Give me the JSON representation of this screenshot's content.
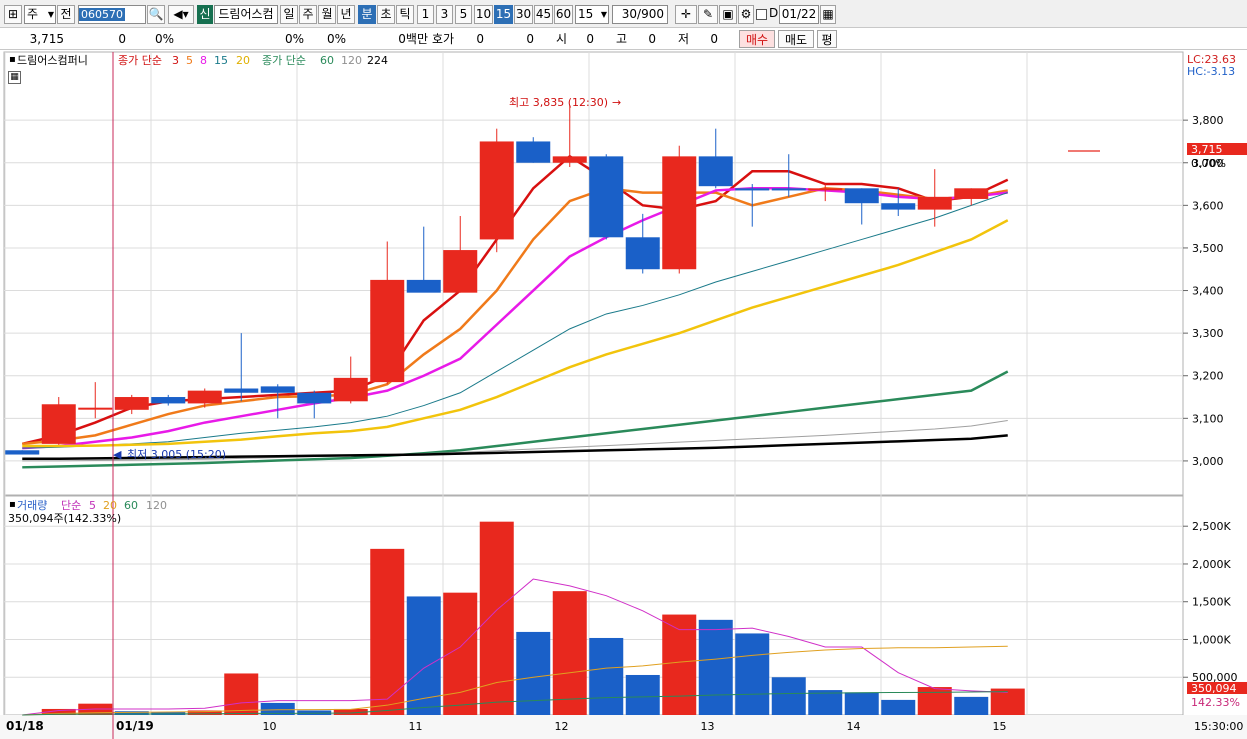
{
  "toolbar": {
    "type_select": "주",
    "prev_label": "전",
    "stock_code": "060570",
    "new_badge": "신",
    "stock_name": "드림어스컴",
    "period_tabs": [
      "일",
      "주",
      "월",
      "년",
      "분",
      "초",
      "틱"
    ],
    "interval_buttons": [
      "1",
      "3",
      "5",
      "10",
      "15",
      "30",
      "45",
      "60"
    ],
    "interval_value": "15",
    "count_value": "30/900",
    "checkbox_label": "D",
    "date_value": "01/22"
  },
  "quote": {
    "price": "3,715",
    "change": "0",
    "change_rate": "0%",
    "v1": "0%",
    "v2": "0%",
    "amount": "0백만",
    "hoga_label": "호가",
    "hoga_v1": "0",
    "hoga_v2": "0",
    "open_label": "시",
    "open": "0",
    "high_label": "고",
    "high": "0",
    "low_label": "저",
    "low": "0",
    "buy_label": "매수",
    "sell_label": "매도",
    "eval_label": "평"
  },
  "price_panel": {
    "stock_tab": "드림어스컴퍼니",
    "ma_title": "종가 단순",
    "ma_periods": [
      "3",
      "5",
      "8",
      "15",
      "20"
    ],
    "ma_title2": "종가 단순",
    "ma_periods2": [
      "60",
      "120",
      "224"
    ],
    "lc_label": "LC:23.63",
    "hc_label": "HC:-3.13",
    "current_price_tag": "3,715",
    "current_pct_tag": "0.00%",
    "high_annotation": "최고 3,835 (12:30)",
    "low_annotation": "최저 3,005 (15:20)"
  },
  "volume_panel": {
    "title": "거래량",
    "ma_title": "단순",
    "ma_periods": [
      "5",
      "20",
      "60",
      "120"
    ],
    "info": "350,094주(142.33%)",
    "current_tag": "350,094",
    "current_pct": "142.33%"
  },
  "axis": {
    "date_left": "01/18",
    "date_first": "01/19",
    "x_labels": [
      "10",
      "11",
      "12",
      "13",
      "14",
      "15"
    ],
    "time_label": "15:30:00"
  },
  "chart_data": {
    "type": "candlestick",
    "price_ylim": [
      2920,
      3960
    ],
    "price_ticks": [
      "3,000",
      "3,100",
      "3,200",
      "3,300",
      "3,400",
      "3,500",
      "3,600",
      "3,700",
      "3,800"
    ],
    "volume_ylim": [
      0,
      2900
    ],
    "volume_ticks": [
      "500,000",
      "1,000K",
      "1,500K",
      "2,000K",
      "2,500K"
    ],
    "candles": [
      {
        "o": 3025,
        "h": 3025,
        "l": 3015,
        "c": 3015
      },
      {
        "o": 3040,
        "h": 3150,
        "l": 3038,
        "c": 3133
      },
      {
        "o": 3125,
        "h": 3185,
        "l": 3100,
        "c": 3125
      },
      {
        "o": 3120,
        "h": 3155,
        "l": 3110,
        "c": 3150
      },
      {
        "o": 3150,
        "h": 3155,
        "l": 3130,
        "c": 3135
      },
      {
        "o": 3135,
        "h": 3170,
        "l": 3125,
        "c": 3165
      },
      {
        "o": 3170,
        "h": 3300,
        "l": 3140,
        "c": 3160
      },
      {
        "o": 3175,
        "h": 3180,
        "l": 3100,
        "c": 3160
      },
      {
        "o": 3160,
        "h": 3165,
        "l": 3100,
        "c": 3135
      },
      {
        "o": 3140,
        "h": 3245,
        "l": 3135,
        "c": 3195
      },
      {
        "o": 3185,
        "h": 3515,
        "l": 3180,
        "c": 3425
      },
      {
        "o": 3425,
        "h": 3550,
        "l": 3400,
        "c": 3395
      },
      {
        "o": 3395,
        "h": 3575,
        "l": 3395,
        "c": 3495
      },
      {
        "o": 3520,
        "h": 3780,
        "l": 3490,
        "c": 3750
      },
      {
        "o": 3750,
        "h": 3760,
        "l": 3700,
        "c": 3700
      },
      {
        "o": 3700,
        "h": 3835,
        "l": 3690,
        "c": 3715
      },
      {
        "o": 3715,
        "h": 3720,
        "l": 3520,
        "c": 3525
      },
      {
        "o": 3525,
        "h": 3580,
        "l": 3440,
        "c": 3450
      },
      {
        "o": 3450,
        "h": 3740,
        "l": 3440,
        "c": 3715
      },
      {
        "o": 3715,
        "h": 3780,
        "l": 3640,
        "c": 3645
      },
      {
        "o": 3640,
        "h": 3650,
        "l": 3550,
        "c": 3635
      },
      {
        "o": 3640,
        "h": 3720,
        "l": 3620,
        "c": 3635
      },
      {
        "o": 3640,
        "h": 3650,
        "l": 3610,
        "c": 3640
      },
      {
        "o": 3640,
        "h": 3640,
        "l": 3555,
        "c": 3605
      },
      {
        "o": 3605,
        "h": 3640,
        "l": 3575,
        "c": 3590
      },
      {
        "o": 3590,
        "h": 3685,
        "l": 3550,
        "c": 3620
      },
      {
        "o": 3615,
        "h": 3640,
        "l": 3600,
        "c": 3640
      },
      {
        "o": 3715,
        "h": 3715,
        "l": 3715,
        "c": 3715
      }
    ],
    "ma_series": [
      {
        "name": "3",
        "color": "#d81010",
        "values": [
          3040,
          3060,
          3090,
          3125,
          3140,
          3145,
          3150,
          3155,
          3160,
          3165,
          3200,
          3330,
          3400,
          3520,
          3640,
          3715,
          3660,
          3600,
          3590,
          3610,
          3680,
          3680,
          3650,
          3650,
          3640,
          3610,
          3620,
          3660
        ]
      },
      {
        "name": "5",
        "color": "#f07a1a",
        "values": [
          3040,
          3048,
          3060,
          3085,
          3110,
          3130,
          3140,
          3150,
          3152,
          3155,
          3180,
          3250,
          3310,
          3400,
          3520,
          3610,
          3640,
          3630,
          3630,
          3630,
          3600,
          3620,
          3640,
          3635,
          3625,
          3615,
          3620,
          3635
        ]
      },
      {
        "name": "8",
        "color": "#e81ae8",
        "values": [
          3030,
          3035,
          3045,
          3055,
          3070,
          3090,
          3105,
          3120,
          3135,
          3148,
          3165,
          3200,
          3240,
          3320,
          3400,
          3480,
          3525,
          3565,
          3600,
          3635,
          3640,
          3640,
          3635,
          3630,
          3620,
          3615,
          3620,
          3630
        ]
      },
      {
        "name": "15",
        "color": "#1a7a8a",
        "values": [
          3030,
          3032,
          3036,
          3040,
          3045,
          3055,
          3065,
          3072,
          3080,
          3090,
          3105,
          3130,
          3160,
          3210,
          3260,
          3310,
          3345,
          3365,
          3390,
          3420,
          3445,
          3470,
          3495,
          3520,
          3545,
          3570,
          3600,
          3630
        ]
      },
      {
        "name": "20",
        "color": "#f2c40c",
        "values": [
          3035,
          3035,
          3036,
          3038,
          3040,
          3045,
          3050,
          3058,
          3065,
          3070,
          3080,
          3100,
          3120,
          3150,
          3185,
          3220,
          3250,
          3275,
          3300,
          3330,
          3360,
          3385,
          3410,
          3435,
          3460,
          3490,
          3520,
          3565
        ]
      },
      {
        "name": "60",
        "color": "#2a8a5a",
        "values": [
          2985,
          2987,
          2989,
          2991,
          2993,
          2995,
          2998,
          3001,
          3004,
          3007,
          3012,
          3018,
          3025,
          3035,
          3045,
          3055,
          3065,
          3075,
          3085,
          3095,
          3105,
          3115,
          3125,
          3135,
          3145,
          3155,
          3165,
          3210
        ]
      },
      {
        "name": "120",
        "color": "#a0a0a0",
        "values": [
          3000,
          3000,
          3001,
          3002,
          3003,
          3004,
          3006,
          3008,
          3010,
          3012,
          3014,
          3017,
          3020,
          3024,
          3028,
          3032,
          3036,
          3040,
          3044,
          3048,
          3052,
          3056,
          3060,
          3065,
          3070,
          3075,
          3082,
          3095
        ]
      },
      {
        "name": "224",
        "color": "#000000",
        "values": [
          3005,
          3005,
          3006,
          3007,
          3008,
          3009,
          3010,
          3011,
          3012,
          3013,
          3014,
          3015,
          3017,
          3019,
          3021,
          3023,
          3025,
          3027,
          3029,
          3031,
          3034,
          3037,
          3040,
          3043,
          3046,
          3049,
          3052,
          3060
        ]
      }
    ],
    "volume": [
      {
        "v": 0,
        "up": true
      },
      {
        "v": 80,
        "up": true
      },
      {
        "v": 150,
        "up": true
      },
      {
        "v": 50,
        "up": false
      },
      {
        "v": 40,
        "up": false
      },
      {
        "v": 60,
        "up": true
      },
      {
        "v": 550,
        "up": true
      },
      {
        "v": 160,
        "up": false
      },
      {
        "v": 60,
        "up": false
      },
      {
        "v": 80,
        "up": true
      },
      {
        "v": 2200,
        "up": true
      },
      {
        "v": 1570,
        "up": false
      },
      {
        "v": 1620,
        "up": true
      },
      {
        "v": 2560,
        "up": true
      },
      {
        "v": 1100,
        "up": false
      },
      {
        "v": 1640,
        "up": true
      },
      {
        "v": 1020,
        "up": false
      },
      {
        "v": 530,
        "up": false
      },
      {
        "v": 1330,
        "up": true
      },
      {
        "v": 1260,
        "up": false
      },
      {
        "v": 1080,
        "up": false
      },
      {
        "v": 500,
        "up": false
      },
      {
        "v": 330,
        "up": false
      },
      {
        "v": 300,
        "up": false
      },
      {
        "v": 200,
        "up": false
      },
      {
        "v": 370,
        "up": true
      },
      {
        "v": 240,
        "up": false
      },
      {
        "v": 350,
        "up": true
      }
    ],
    "volume_ma": [
      {
        "name": "5",
        "color": "#d030c8",
        "values": [
          0,
          60,
          80,
          80,
          80,
          90,
          160,
          190,
          190,
          190,
          210,
          620,
          900,
          1390,
          1800,
          1710,
          1580,
          1380,
          1130,
          1130,
          1150,
          1040,
          900,
          900,
          560,
          350,
          320,
          300
        ]
      },
      {
        "name": "20",
        "color": "#e0a020",
        "values": [
          0,
          20,
          30,
          35,
          40,
          45,
          60,
          70,
          72,
          74,
          130,
          220,
          300,
          430,
          500,
          560,
          620,
          650,
          700,
          740,
          790,
          830,
          860,
          880,
          890,
          890,
          900,
          910
        ]
      },
      {
        "name": "60",
        "color": "#2a8a5a",
        "values": [
          0,
          10,
          12,
          14,
          15,
          16,
          20,
          22,
          24,
          26,
          60,
          100,
          130,
          170,
          190,
          210,
          230,
          240,
          250,
          265,
          275,
          285,
          290,
          295,
          298,
          300,
          305,
          310
        ]
      }
    ]
  }
}
